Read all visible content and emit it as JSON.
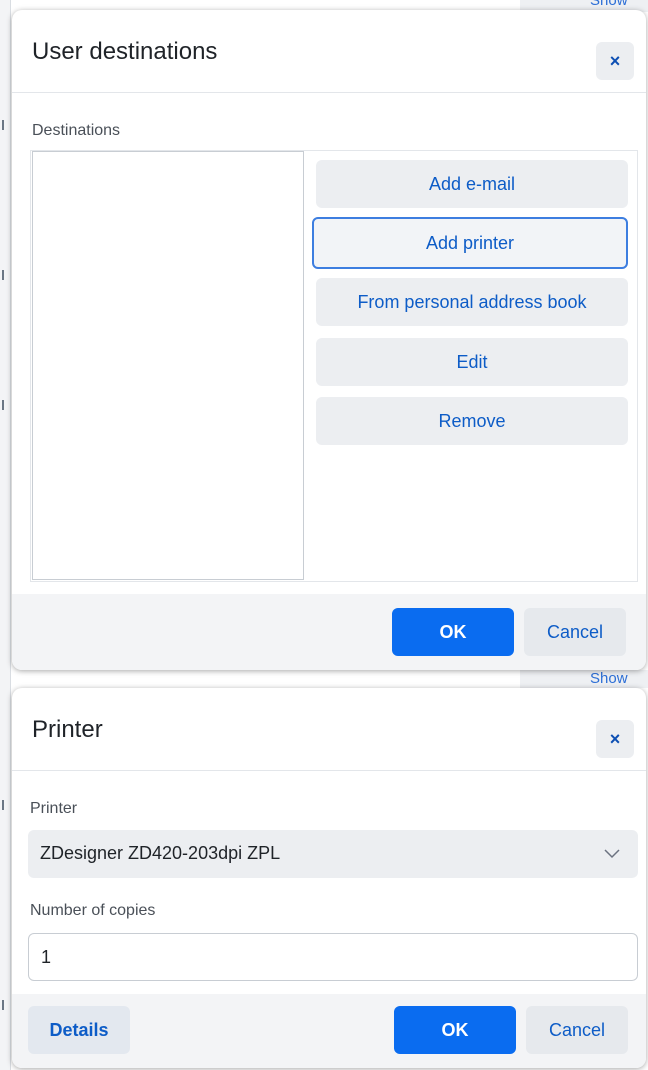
{
  "background": {
    "top_word": "Show",
    "bottom_word": "Show"
  },
  "user_destinations": {
    "title": "User destinations",
    "close_symbol": "×",
    "list_label": "Destinations",
    "buttons": {
      "add_email": "Add e-mail",
      "add_printer": "Add printer",
      "from_address_book": "From personal address book",
      "edit": "Edit",
      "remove": "Remove"
    },
    "ok": "OK",
    "cancel": "Cancel"
  },
  "printer_dialog": {
    "title": "Printer",
    "close_symbol": "×",
    "printer_label": "Printer",
    "printer_value": "ZDesigner ZD420-203dpi ZPL",
    "copies_label": "Number of copies",
    "copies_value": "1",
    "details": "Details",
    "ok": "OK",
    "cancel": "Cancel"
  },
  "colors": {
    "primary": "#0a6cf0",
    "link_text": "#0d5cc7",
    "button_bg": "#eceef1",
    "focus_border": "#3d7ee0"
  }
}
